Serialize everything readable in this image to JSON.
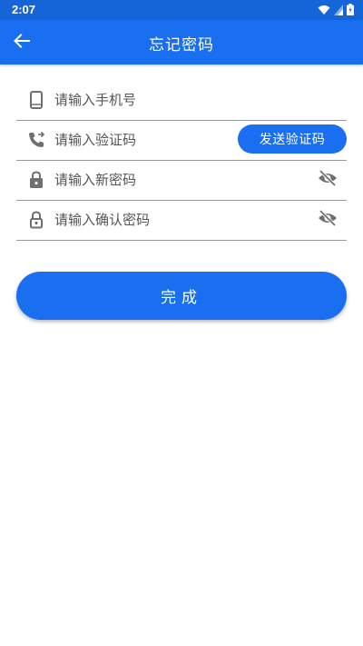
{
  "status_bar": {
    "time": "2:07",
    "icons": [
      "wifi-icon",
      "signal-icon",
      "battery-icon"
    ]
  },
  "app_bar": {
    "back_icon": "arrow-left-icon",
    "title": "忘记密码"
  },
  "form": {
    "phone": {
      "icon": "smartphone-icon",
      "placeholder": "请输入手机号",
      "value": ""
    },
    "code": {
      "icon": "phone-forward-icon",
      "placeholder": "请输入验证码",
      "value": "",
      "send_button_label": "发送验证码"
    },
    "new_password": {
      "icon": "lock-icon",
      "placeholder": "请输入新密码",
      "value": "",
      "toggle_icon": "eye-off-icon"
    },
    "confirm_password": {
      "icon": "lock-outline-icon",
      "placeholder": "请输入确认密码",
      "value": "",
      "toggle_icon": "eye-off-icon"
    }
  },
  "done_button": {
    "label": "完成"
  },
  "colors": {
    "primary": "#1a6ff0",
    "status_bar": "#1565d8",
    "icon_gray": "#6f6f6f",
    "divider": "#9a9a9a"
  }
}
